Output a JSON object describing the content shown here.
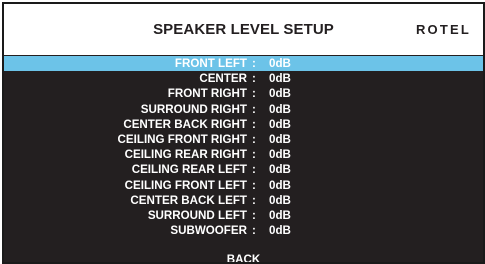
{
  "header": {
    "title": "SPEAKER LEVEL SETUP",
    "brand": "ROTEL"
  },
  "separator": ":",
  "selected_index": 0,
  "colors": {
    "selection": "#6cc3e8",
    "background": "#231f20",
    "text": "#ffffff"
  },
  "items": [
    {
      "label": "FRONT LEFT",
      "value": "0dB"
    },
    {
      "label": "CENTER",
      "value": "0dB"
    },
    {
      "label": "FRONT RIGHT",
      "value": "0dB"
    },
    {
      "label": "SURROUND RIGHT",
      "value": "0dB"
    },
    {
      "label": "CENTER BACK RIGHT",
      "value": "0dB"
    },
    {
      "label": "CEILING FRONT RIGHT",
      "value": "0dB"
    },
    {
      "label": "CEILING REAR RIGHT",
      "value": "0dB"
    },
    {
      "label": "CEILING REAR LEFT",
      "value": "0dB"
    },
    {
      "label": "CEILING FRONT LEFT",
      "value": "0dB"
    },
    {
      "label": "CENTER BACK LEFT",
      "value": "0dB"
    },
    {
      "label": "SURROUND LEFT",
      "value": "0dB"
    },
    {
      "label": "SUBWOOFER",
      "value": "0dB"
    }
  ],
  "back_label": "BACK"
}
